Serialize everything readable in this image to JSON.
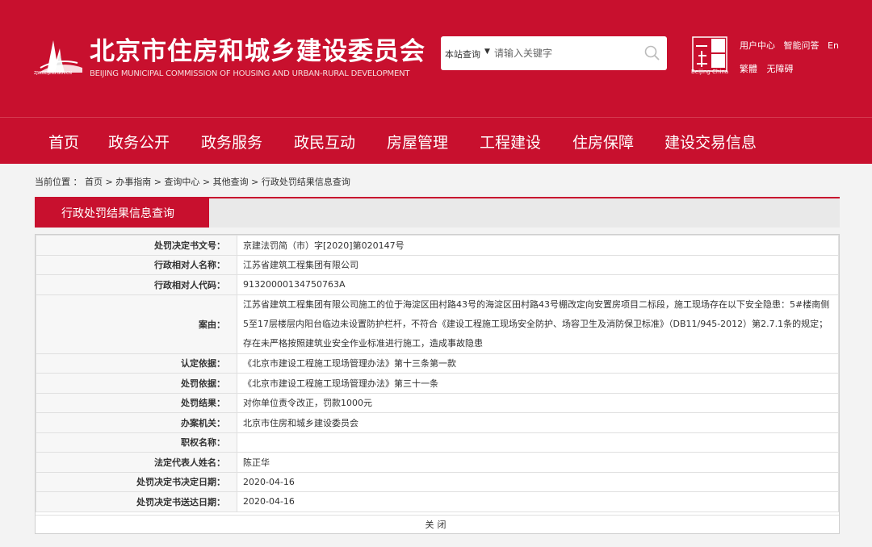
{
  "header": {
    "title": "北京市住房和城乡建设委员会",
    "subtitle": "BEIJING MUNICIPAL COMMISSION OF HOUSING AND URBAN-RURAL DEVELOPMENT",
    "logo_url": "ZJW.BEIJING.GOV.CN",
    "search_scope": "本站查询",
    "search_placeholder": "请输入关键字",
    "seal_caption": "Beijing·China",
    "links_row1": [
      "用户中心",
      "智能问答",
      "En"
    ],
    "links_row2": [
      "繁體",
      "无障碍"
    ]
  },
  "nav": [
    "首页",
    "政务公开",
    "政务服务",
    "政民互动",
    "房屋管理",
    "工程建设",
    "住房保障",
    "建设交易信息"
  ],
  "breadcrumb": [
    "当前位置 ：",
    "首页",
    " > ",
    "办事指南",
    " > ",
    "查询中心",
    " > ",
    "其他查询",
    " > ",
    "行政处罚结果信息查询"
  ],
  "tab": {
    "label": "行政处罚结果信息查询"
  },
  "rows": [
    {
      "label": "处罚决定书文号：",
      "value": "京建法罚简（市）字[2020]第020147号"
    },
    {
      "label": "行政相对人名称：",
      "value": "江苏省建筑工程集团有限公司"
    },
    {
      "label": "行政相对人代码：",
      "value": "91320000134750763A"
    },
    {
      "label": "案由：",
      "value": "江苏省建筑工程集团有限公司施工的位于海淀区田村路43号的海淀区田村路43号棚改定向安置房项目二标段，施工现场存在以下安全隐患：5#楼南侧5至17层楼层内阳台临边未设置防护栏杆，不符合《建设工程施工现场安全防护、场容卫生及消防保卫标准》（DB11/945-2012）第2.7.1条的规定；存在未严格按照建筑业安全作业标准进行施工，造成事故隐患"
    },
    {
      "label": "认定依据：",
      "value": "《北京市建设工程施工现场管理办法》第十三条第一款"
    },
    {
      "label": "处罚依据：",
      "value": "《北京市建设工程施工现场管理办法》第三十一条"
    },
    {
      "label": "处罚结果：",
      "value": "对你单位责令改正，罚款1000元"
    },
    {
      "label": "办案机关：",
      "value": "北京市住房和城乡建设委员会"
    },
    {
      "label": "职权名称：",
      "value": ""
    },
    {
      "label": "法定代表人姓名：",
      "value": "陈正华"
    },
    {
      "label": "处罚决定书决定日期：",
      "value": "2020-04-16"
    },
    {
      "label": "处罚决定书送达日期：",
      "value": "2020-04-16"
    }
  ],
  "close_label": "关闭",
  "colors": {
    "brand_red": "#c8102e"
  }
}
